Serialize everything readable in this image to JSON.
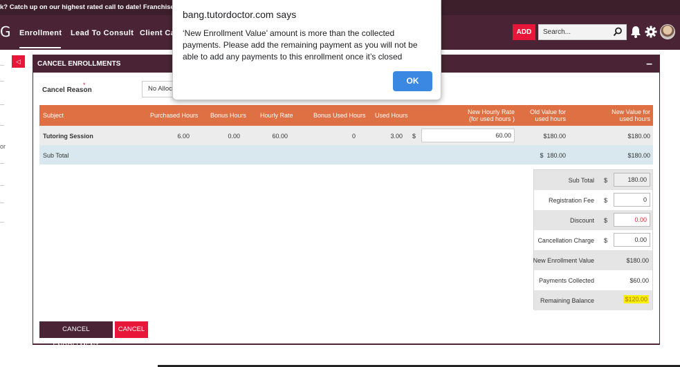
{
  "announcement": "k? Catch up on our highest rated call to date! Franchisee Panel: Taking",
  "nav": {
    "logo_fragment": "G",
    "items": [
      "Enrollment",
      "Lead To Consult",
      "Client Ca"
    ],
    "add_label": "ADD",
    "search_placeholder": "Search..."
  },
  "sidebar": {
    "letter": "or",
    "toggle": "◁"
  },
  "panel": {
    "title": "CANCEL ENROLLMENTS",
    "collapse": "–",
    "cancel_reason_label": "Cancel Reason",
    "required_mark": "*",
    "cancel_reason_value": "No Allocati"
  },
  "table": {
    "headers": {
      "subject": "Subject",
      "purchased_hours": "Purchased Hours",
      "bonus_hours": "Bonus Hours",
      "hourly_rate": "Hourly Rate",
      "bonus_used_hours": "Bonus Used Hours",
      "used_hours": "Used Hours",
      "new_hourly_rate_1": "New Hourly Rate",
      "new_hourly_rate_2": "(for used hours )",
      "old_value_1": "Old Value for",
      "old_value_2": "used hours",
      "new_value_1": "New Value for",
      "new_value_2": "used hours"
    },
    "row": {
      "subject": "Tutoring Session",
      "purchased_hours": "6.00",
      "bonus_hours": "0.00",
      "hourly_rate": "60.00",
      "bonus_used_hours": "0",
      "used_hours": "3.00",
      "currency": "$",
      "new_hourly_rate": "60.00",
      "old_value": "$180.00",
      "new_value": "$180.00"
    },
    "subtotal": {
      "label": "Sub Total",
      "old_value": "$  180.00",
      "new_value": "$180.00"
    }
  },
  "summary": {
    "currency": "$",
    "sub_total_label": "Sub Total",
    "sub_total": "180.00",
    "registration_fee_label": "Registration Fee",
    "registration_fee": "0",
    "discount_label": "Discount",
    "discount": "0.00",
    "cancellation_charge_label": "Cancellation Charge",
    "cancellation_charge": "0.00",
    "new_enrollment_value_label": "New Enrollment Value",
    "new_enrollment_value": "$180.00",
    "payments_collected_label": "Payments Collected",
    "payments_collected": "$60.00",
    "remaining_balance_label": "Remaining Balance",
    "remaining_balance": "$120.00"
  },
  "buttons": {
    "cancel_enrollment": "CANCEL ENROLLMENT",
    "cancel": "CANCEL"
  },
  "dialog": {
    "title": "bang.tutordoctor.com says",
    "message": "‘New Enrollment Value’ amount is more than the collected payments. Please add the remaining payment as you will not be able to add any payments to this enrollment once it’s closed",
    "ok_label": "OK"
  },
  "colors": {
    "brand_dark": "#4a2434",
    "accent_red": "#e8173a",
    "table_header": "#df7044",
    "highlight": "#f7f000",
    "dialog_button": "#3b88e3"
  }
}
